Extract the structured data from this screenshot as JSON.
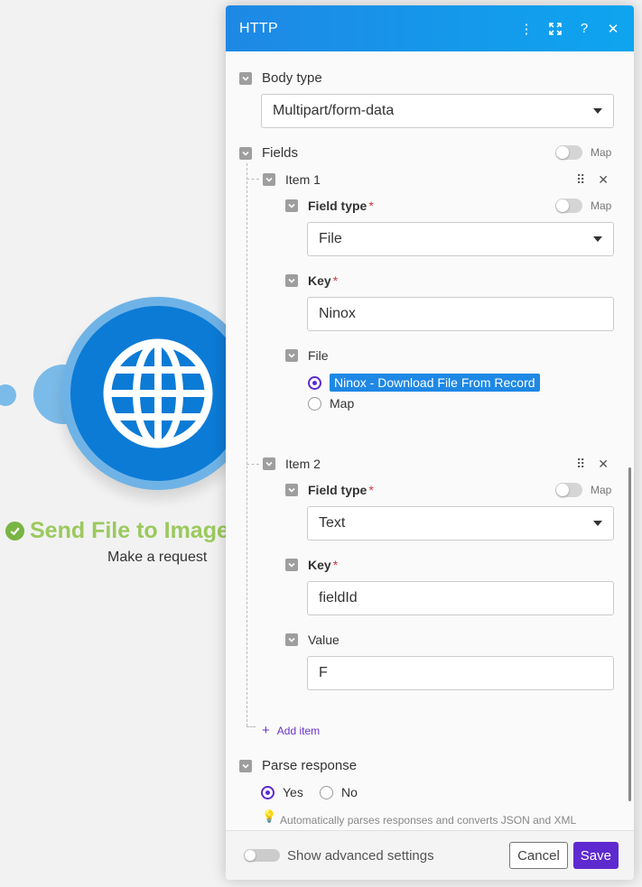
{
  "module": {
    "name": "Send File to Image",
    "subtitle": "Make a request"
  },
  "panel": {
    "title": "HTTP",
    "body_type": {
      "label": "Body type",
      "value": "Multipart/form-data"
    },
    "fields": {
      "label": "Fields",
      "map_label": "Map",
      "items": [
        {
          "label": "Item 1",
          "field_type": {
            "label": "Field type",
            "value": "File",
            "map_label": "Map"
          },
          "key": {
            "label": "Key",
            "value": "Ninox"
          },
          "file": {
            "label": "File",
            "option_selected": "Ninox - Download File From Record",
            "option_map": "Map"
          }
        },
        {
          "label": "Item 2",
          "field_type": {
            "label": "Field type",
            "value": "Text",
            "map_label": "Map"
          },
          "key": {
            "label": "Key",
            "value": "fieldId"
          },
          "value": {
            "label": "Value",
            "value": "F"
          }
        }
      ],
      "add_item": "Add item"
    },
    "parse_response": {
      "label": "Parse response",
      "yes": "Yes",
      "no": "No",
      "hint": "Automatically parses responses and converts JSON and XML responses so you don't need to use JSON or XML parser. Before"
    },
    "footer": {
      "advanced": "Show advanced settings",
      "cancel": "Cancel",
      "save": "Save"
    }
  },
  "colors": {
    "header": "#1e88e5",
    "save": "#5e2ad0",
    "module": "#0c7bd6",
    "module_name": "#9bc95d"
  }
}
